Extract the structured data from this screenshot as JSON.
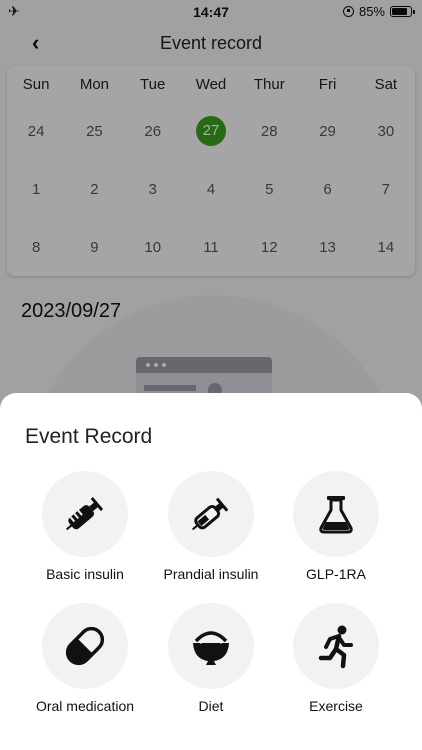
{
  "status_bar": {
    "time": "14:47",
    "battery": "85%",
    "battery_level": 0.85
  },
  "nav": {
    "title": "Event record",
    "back_icon": "chevron-left-icon"
  },
  "calendar": {
    "weekdays": [
      "Sun",
      "Mon",
      "Tue",
      "Wed",
      "Thur",
      "Fri",
      "Sat"
    ],
    "weeks": [
      [
        "24",
        "25",
        "26",
        "27",
        "28",
        "29",
        "30"
      ],
      [
        "1",
        "2",
        "3",
        "4",
        "5",
        "6",
        "7"
      ],
      [
        "8",
        "9",
        "10",
        "11",
        "12",
        "13",
        "14"
      ]
    ],
    "selected_day": "27",
    "selected_color": "#3aa01a"
  },
  "selected_date": "2023/09/27",
  "sheet": {
    "title": "Event Record",
    "items": [
      {
        "label": "Basic insulin",
        "icon": "syringe-icon"
      },
      {
        "label": "Prandial insulin",
        "icon": "syringe-outline-icon"
      },
      {
        "label": "GLP-1RA",
        "icon": "flask-icon"
      },
      {
        "label": "Oral medication",
        "icon": "pill-icon"
      },
      {
        "label": "Diet",
        "icon": "bowl-icon"
      },
      {
        "label": "Exercise",
        "icon": "running-icon"
      }
    ]
  }
}
